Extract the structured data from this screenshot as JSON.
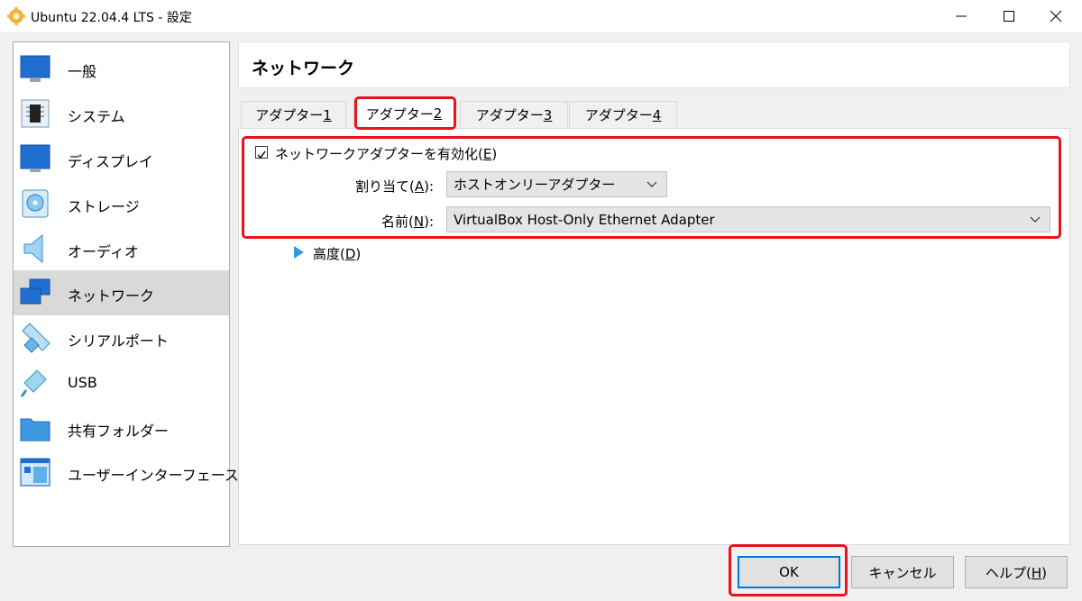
{
  "window": {
    "title": "Ubuntu 22.04.4 LTS - 設定",
    "icon": "gear-icon",
    "controls": [
      "minimize-icon",
      "maximize-icon",
      "close-icon"
    ]
  },
  "sidebar": {
    "items": [
      {
        "label": "一般",
        "icon": "general-monitor-icon",
        "selected": false
      },
      {
        "label": "システム",
        "icon": "chip-icon",
        "selected": false
      },
      {
        "label": "ディスプレイ",
        "icon": "display-icon",
        "selected": false
      },
      {
        "label": "ストレージ",
        "icon": "storage-disk-icon",
        "selected": false
      },
      {
        "label": "オーディオ",
        "icon": "speaker-icon",
        "selected": false
      },
      {
        "label": "ネットワーク",
        "icon": "network-icon",
        "selected": true
      },
      {
        "label": "シリアルポート",
        "icon": "serial-port-icon",
        "selected": false
      },
      {
        "label": "USB",
        "icon": "usb-icon",
        "selected": false
      },
      {
        "label": "共有フォルダー",
        "icon": "folder-icon",
        "selected": false
      },
      {
        "label": "ユーザーインターフェース",
        "icon": "user-interface-icon",
        "selected": false
      }
    ]
  },
  "main": {
    "title": "ネットワーク",
    "tabs": [
      {
        "label": "アダプター ",
        "key": "1",
        "active": false
      },
      {
        "label": "アダプター ",
        "key": "2",
        "active": true
      },
      {
        "label": "アダプター ",
        "key": "3",
        "active": false
      },
      {
        "label": "アダプター ",
        "key": "4",
        "active": false
      }
    ],
    "enable_adapter": {
      "label": "ネットワークアダプターを有効化(",
      "key": "E",
      "suffix": ")",
      "checked": true
    },
    "attached_to": {
      "label": "割り当て(",
      "key": "A",
      "suffix": "):",
      "value": "ホストオンリーアダプター"
    },
    "name": {
      "label": "名前(",
      "key": "N",
      "suffix": "):",
      "value": "VirtualBox Host-Only Ethernet Adapter"
    },
    "advanced": {
      "label": "高度(",
      "key": "D",
      "suffix": ")"
    }
  },
  "buttons": {
    "ok": "OK",
    "cancel": "キャンセル",
    "help": {
      "label": "ヘルプ(",
      "key": "H",
      "suffix": ")"
    }
  },
  "colors": {
    "highlight_box": "#e8141a",
    "selected_item_bg": "#d9d9d9",
    "primary_border": "#0078d7",
    "advanced_arrow": "#2e9be0"
  }
}
